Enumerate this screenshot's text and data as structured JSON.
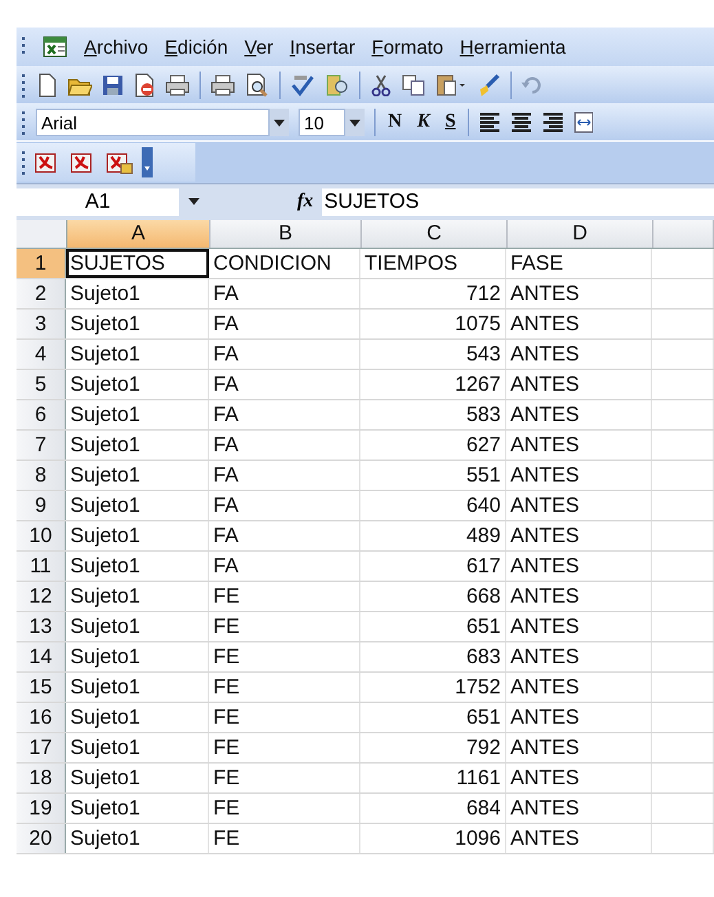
{
  "menu_bar": {
    "items": [
      "Archivo",
      "Edición",
      "Ver",
      "Insertar",
      "Formato",
      "Herramienta"
    ]
  },
  "format_toolbar": {
    "font": "Arial",
    "size": "10",
    "style_buttons": [
      "N",
      "K",
      "S"
    ]
  },
  "formula_bar": {
    "name_box": "A1",
    "function_label": "fx",
    "content": "SUJETOS"
  },
  "columns": [
    {
      "label": "A",
      "selected": true
    },
    {
      "label": "B",
      "selected": false
    },
    {
      "label": "C",
      "selected": false
    },
    {
      "label": "D",
      "selected": false
    }
  ],
  "rows": [
    {
      "number": "1",
      "kind": "header",
      "selected": true,
      "cells": [
        "SUJETOS",
        "CONDICION",
        "TIEMPOS",
        "FASE"
      ]
    },
    {
      "number": "2",
      "kind": "data",
      "selected": false,
      "cells": [
        "Sujeto1",
        "FA",
        "712",
        "ANTES"
      ]
    },
    {
      "number": "3",
      "kind": "data",
      "selected": false,
      "cells": [
        "Sujeto1",
        "FA",
        "1075",
        "ANTES"
      ]
    },
    {
      "number": "4",
      "kind": "data",
      "selected": false,
      "cells": [
        "Sujeto1",
        "FA",
        "543",
        "ANTES"
      ]
    },
    {
      "number": "5",
      "kind": "data",
      "selected": false,
      "cells": [
        "Sujeto1",
        "FA",
        "1267",
        "ANTES"
      ]
    },
    {
      "number": "6",
      "kind": "data",
      "selected": false,
      "cells": [
        "Sujeto1",
        "FA",
        "583",
        "ANTES"
      ]
    },
    {
      "number": "7",
      "kind": "data",
      "selected": false,
      "cells": [
        "Sujeto1",
        "FA",
        "627",
        "ANTES"
      ]
    },
    {
      "number": "8",
      "kind": "data",
      "selected": false,
      "cells": [
        "Sujeto1",
        "FA",
        "551",
        "ANTES"
      ]
    },
    {
      "number": "9",
      "kind": "data",
      "selected": false,
      "cells": [
        "Sujeto1",
        "FA",
        "640",
        "ANTES"
      ]
    },
    {
      "number": "10",
      "kind": "data",
      "selected": false,
      "cells": [
        "Sujeto1",
        "FA",
        "489",
        "ANTES"
      ]
    },
    {
      "number": "11",
      "kind": "data",
      "selected": false,
      "cells": [
        "Sujeto1",
        "FA",
        "617",
        "ANTES"
      ]
    },
    {
      "number": "12",
      "kind": "data",
      "selected": false,
      "cells": [
        "Sujeto1",
        "FE",
        "668",
        "ANTES"
      ]
    },
    {
      "number": "13",
      "kind": "data",
      "selected": false,
      "cells": [
        "Sujeto1",
        "FE",
        "651",
        "ANTES"
      ]
    },
    {
      "number": "14",
      "kind": "data",
      "selected": false,
      "cells": [
        "Sujeto1",
        "FE",
        "683",
        "ANTES"
      ]
    },
    {
      "number": "15",
      "kind": "data",
      "selected": false,
      "cells": [
        "Sujeto1",
        "FE",
        "1752",
        "ANTES"
      ]
    },
    {
      "number": "16",
      "kind": "data",
      "selected": false,
      "cells": [
        "Sujeto1",
        "FE",
        "651",
        "ANTES"
      ]
    },
    {
      "number": "17",
      "kind": "data",
      "selected": false,
      "cells": [
        "Sujeto1",
        "FE",
        "792",
        "ANTES"
      ]
    },
    {
      "number": "18",
      "kind": "data",
      "selected": false,
      "cells": [
        "Sujeto1",
        "FE",
        "1161",
        "ANTES"
      ]
    },
    {
      "number": "19",
      "kind": "data",
      "selected": false,
      "cells": [
        "Sujeto1",
        "FE",
        "684",
        "ANTES"
      ]
    },
    {
      "number": "20",
      "kind": "data",
      "selected": false,
      "cells": [
        "Sujeto1",
        "FE",
        "1096",
        "ANTES"
      ]
    }
  ]
}
